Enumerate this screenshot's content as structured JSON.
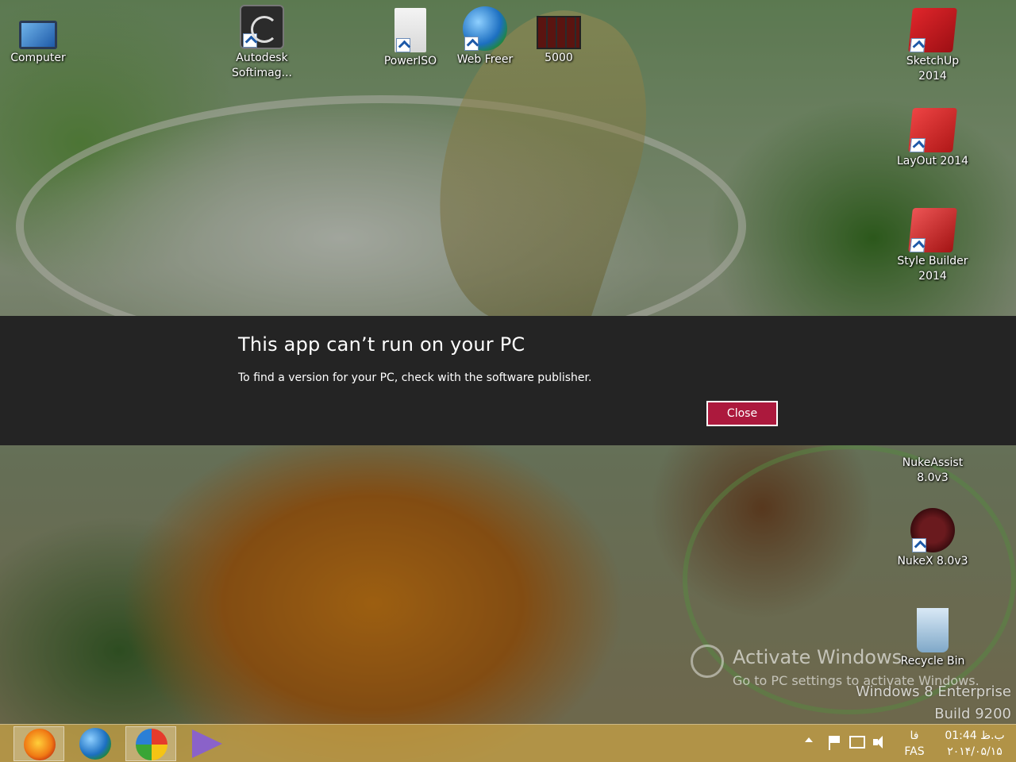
{
  "desktop": {
    "icons": [
      {
        "id": "computer",
        "label": "Computer"
      },
      {
        "id": "softimage",
        "label": "Autodesk Softimag..."
      },
      {
        "id": "poweriso",
        "label": "PowerISO"
      },
      {
        "id": "webfreer",
        "label": "Web Freer"
      },
      {
        "id": "5000",
        "label": "5000"
      },
      {
        "id": "sketchup",
        "label": "SketchUp 2014"
      },
      {
        "id": "layout",
        "label": "LayOut 2014"
      },
      {
        "id": "stylebuilder",
        "label": "Style Builder 2014"
      },
      {
        "id": "nukeassist",
        "label": "NukeAssist 8.0v3"
      },
      {
        "id": "nukex",
        "label": "NukeX 8.0v3"
      },
      {
        "id": "recyclebin",
        "label": "Recycle Bin"
      }
    ]
  },
  "dialog": {
    "title": "This app can’t run on your PC",
    "message": "To find a version for your PC, check with the software publisher.",
    "close_label": "Close",
    "close_color": "#ac193d"
  },
  "watermark": {
    "title": "Activate Windows",
    "subtitle": "Go to PC settings to activate Windows.",
    "edition": "Windows 8 Enterprise",
    "build": "Build 9200"
  },
  "taskbar": {
    "apps": [
      {
        "name": "firefox",
        "icon": "firefox-icon"
      },
      {
        "name": "webfreer",
        "icon": "globe-icon"
      },
      {
        "name": "idm",
        "icon": "download-manager-icon"
      },
      {
        "name": "visual-studio",
        "icon": "visual-studio-icon"
      }
    ],
    "tray": {
      "language_short": "فا",
      "language_code": "FAS",
      "time": "01:44 ب.ظ",
      "date": "۲۰۱۴/۰۵/۱۵"
    }
  }
}
